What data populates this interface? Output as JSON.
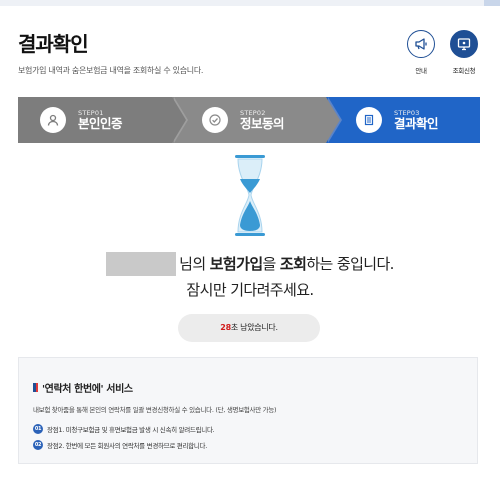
{
  "header": {
    "title": "결과확인",
    "subtitle": "보험가입 내역과 숨은보험금 내역을 조회하실 수 있습니다.",
    "guide_label": "안내",
    "guide_icon": "megaphone-icon",
    "apply_label": "조회신청",
    "apply_icon": "monitor-icon",
    "accent": "#1f4f95"
  },
  "steps": [
    {
      "num": "STEP01",
      "name": "본인인증",
      "icon": "person-icon",
      "state": "done"
    },
    {
      "num": "STEP02",
      "name": "정보동의",
      "icon": "check-icon",
      "state": "done"
    },
    {
      "num": "STEP03",
      "name": "결과확인",
      "icon": "document-icon",
      "state": "active"
    }
  ],
  "status": {
    "name_suffix": "님의 ",
    "keyword1": "보험가입",
    "particle": "을 ",
    "keyword2": "조회",
    "message_end": "하는 중입니다.",
    "wait_message": "잠시만 기다려주세요.",
    "timer_seconds": "28",
    "timer_suffix": "초 남았습니다."
  },
  "service": {
    "title": "'연락처 한번에' 서비스",
    "description": "내보험 찾아줌을 통해 본인의 연락처를 일괄 변경신청하실 수 있습니다. (단, 생명보험사만 가능)",
    "merits": [
      {
        "badge": "01",
        "text": "장점1. 미청구보험금 및 휴면보험금 발생 시 신속히 알려드립니다."
      },
      {
        "badge": "02",
        "text": "장점2. 한번에 모든 회원사의 연락처를 변경하므로 편리합니다."
      }
    ]
  },
  "colors": {
    "step_done": "#7d7d7d",
    "step_active": "#2065c7",
    "timer_number": "#d11c1c",
    "hourglass": "#3a9ad4"
  }
}
